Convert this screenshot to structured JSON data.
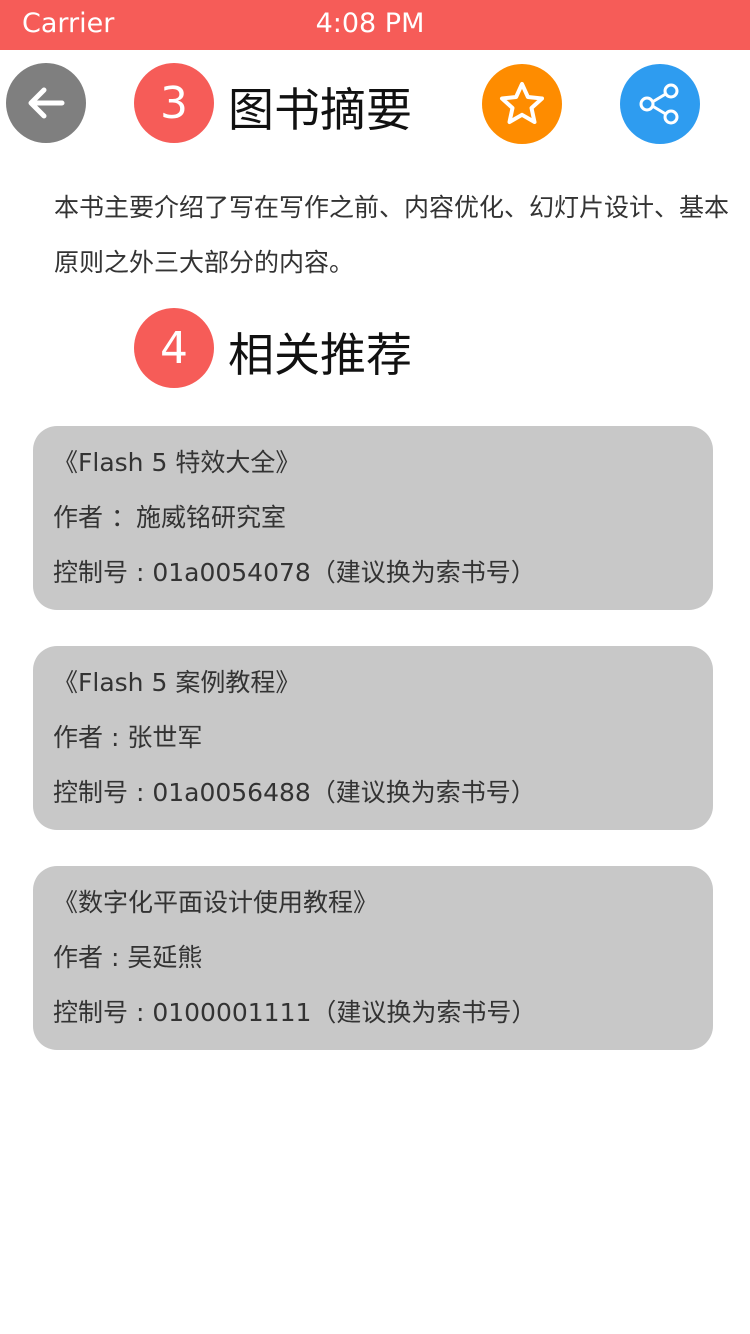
{
  "status_bar": {
    "carrier": "Carrier",
    "time": "4:08 PM"
  },
  "header": {
    "back_icon": "arrow-left-icon",
    "favorite_icon": "star-outline-icon",
    "share_icon": "share-icon"
  },
  "summary_section": {
    "number": "3",
    "title": "图书摘要",
    "text": "本书主要介绍了写在写作之前、内容优化、幻灯片设计、基本原则之外三大部分的内容。"
  },
  "recommend_section": {
    "number": "4",
    "title": "相关推荐",
    "items": [
      {
        "book_title": "《Flash 5 特效大全》",
        "author": "作者 ：施威铭研究室",
        "control_no": "控制号 : 01a0054078（建议换为索书号）"
      },
      {
        "book_title": "《Flash 5 案例教程》",
        "author": "作者 : 张世军",
        "control_no": "控制号 : 01a0056488（建议换为索书号）"
      },
      {
        "book_title": "《数字化平面设计使用教程》",
        "author": "作者 : 吴延熊",
        "control_no": "控制号 : 0100001111（建议换为索书号）"
      }
    ]
  },
  "colors": {
    "accent": "#f65c58",
    "back_button": "#7f7f7f",
    "favorite_button": "#fe8c00",
    "share_button": "#2e9cf0",
    "card_bg": "#c8c8c8"
  }
}
